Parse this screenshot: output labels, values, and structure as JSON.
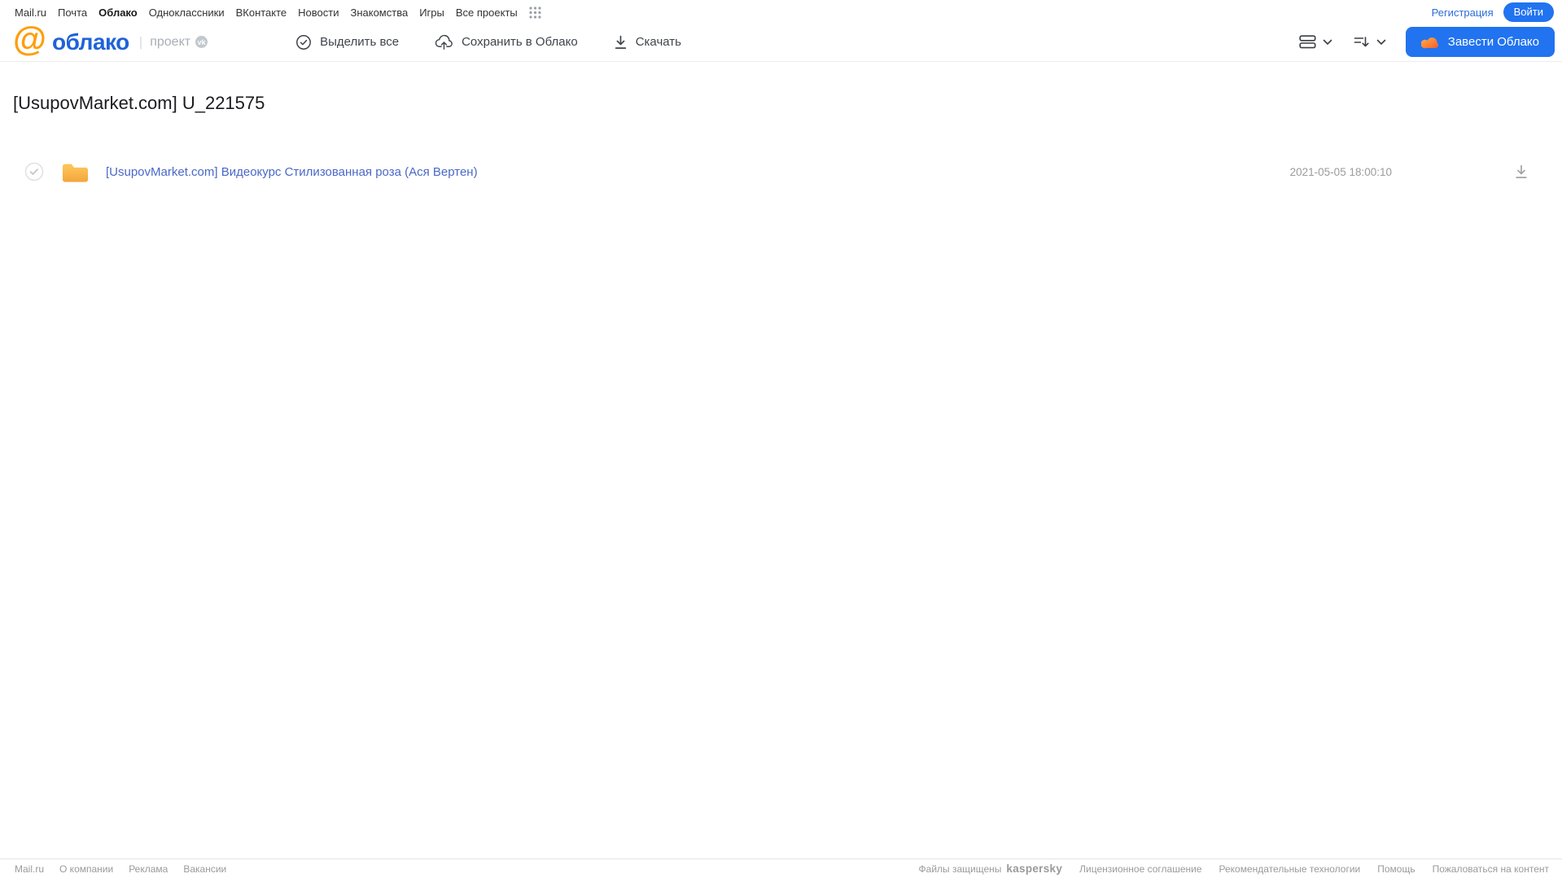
{
  "topnav": {
    "links": [
      {
        "label": "Mail.ru"
      },
      {
        "label": "Почта"
      },
      {
        "label": "Облако"
      },
      {
        "label": "Одноклассники"
      },
      {
        "label": "ВКонтакте"
      },
      {
        "label": "Новости"
      },
      {
        "label": "Знакомства"
      },
      {
        "label": "Игры"
      },
      {
        "label": "Все проекты"
      }
    ],
    "registration_label": "Регистрация",
    "login_label": "Войти"
  },
  "header": {
    "logo_at": "@",
    "logo_text": "облако",
    "logo_separator": "|",
    "project_label": "проект",
    "project_badge": "vk",
    "select_all_label": "Выделить все",
    "save_to_cloud_label": "Сохранить в Облако",
    "download_label": "Скачать",
    "create_cloud_label": "Завести Облако"
  },
  "main": {
    "title": "[UsupovMarket.com] U_221575",
    "files": [
      {
        "type": "folder",
        "name": "[UsupovMarket.com] Видеокурс Стилизованная роза (Ася Вертен)",
        "date": "2021-05-05 18:00:10"
      }
    ]
  },
  "footer": {
    "links_left": [
      {
        "label": "Mail.ru"
      },
      {
        "label": "О компании"
      },
      {
        "label": "Реклама"
      },
      {
        "label": "Вакансии"
      }
    ],
    "protected_label": "Файлы защищены",
    "kaspersky_label": "kaspersky",
    "links_right": [
      {
        "label": "Лицензионное соглашение"
      },
      {
        "label": "Рекомендательные технологии"
      },
      {
        "label": "Помощь"
      },
      {
        "label": "Пожаловаться на контент"
      }
    ]
  },
  "icons": {
    "grid": "all-projects-grid-icon",
    "select_all": "check-circle-icon",
    "save": "cloud-upload-icon",
    "download": "download-icon",
    "view": "list-view-icon",
    "sort": "sort-icon",
    "chevron": "chevron-down-icon",
    "cloud": "cloud-icon",
    "folder": "folder-icon"
  },
  "colors": {
    "accent_blue": "#2173f0",
    "logo_blue": "#1f63d8",
    "logo_orange": "#ff9d0b",
    "file_link_blue": "#4a68c8",
    "kaspersky_teal": "#00a88e",
    "folder_yellow_top": "#ffc95e",
    "folder_yellow_bottom": "#f3a53c",
    "muted_gray": "#9b9b9b"
  }
}
